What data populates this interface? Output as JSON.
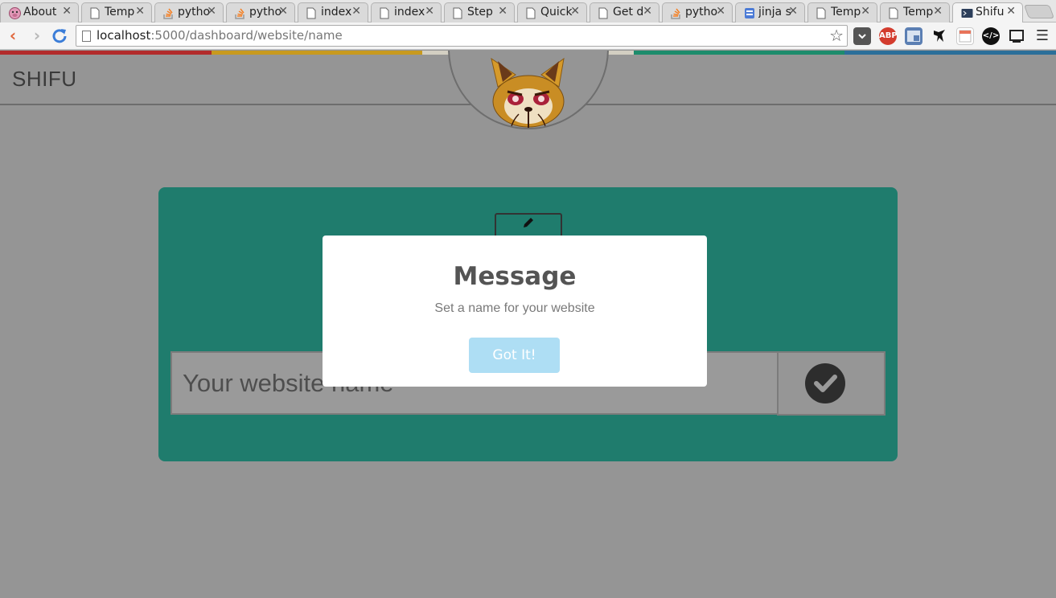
{
  "browser": {
    "tabs": [
      {
        "title": "About",
        "icon": "pig-icon",
        "active": false
      },
      {
        "title": "Temp",
        "icon": "document-icon",
        "active": false
      },
      {
        "title": "pytho",
        "icon": "stackoverflow-icon",
        "active": false
      },
      {
        "title": "pytho",
        "icon": "stackoverflow-icon",
        "active": false
      },
      {
        "title": "index",
        "icon": "document-icon",
        "active": false
      },
      {
        "title": "index",
        "icon": "document-icon",
        "active": false
      },
      {
        "title": "Step",
        "icon": "document-icon",
        "active": false
      },
      {
        "title": "Quick",
        "icon": "document-icon",
        "active": false
      },
      {
        "title": "Get d",
        "icon": "document-icon",
        "active": false
      },
      {
        "title": "pytho",
        "icon": "stackoverflow-icon",
        "active": false
      },
      {
        "title": "jinja s",
        "icon": "docs-icon",
        "active": false
      },
      {
        "title": "Temp",
        "icon": "document-icon",
        "active": false
      },
      {
        "title": "Temp",
        "icon": "document-icon",
        "active": false
      },
      {
        "title": "Shifu",
        "icon": "terminal-icon",
        "active": true
      }
    ],
    "url_host": "localhost",
    "url_rest": ":5000/dashboard/website/name",
    "extensions": [
      "pocket-icon",
      "adblock-icon",
      "window-icon",
      "ninja-icon",
      "calendar-icon",
      "code-icon",
      "cast-icon",
      "menu-icon"
    ]
  },
  "page": {
    "brand": "SHIFU",
    "colorbar": [
      "#b22b2b",
      "#c89a1e",
      "#d3cfc2",
      "#1d8c6c",
      "#2b6f9a"
    ],
    "accent": "#1f7c6d",
    "input_placeholder": "Your website name"
  },
  "modal": {
    "title": "Message",
    "text": "Set a name for your website",
    "button": "Got It!"
  }
}
